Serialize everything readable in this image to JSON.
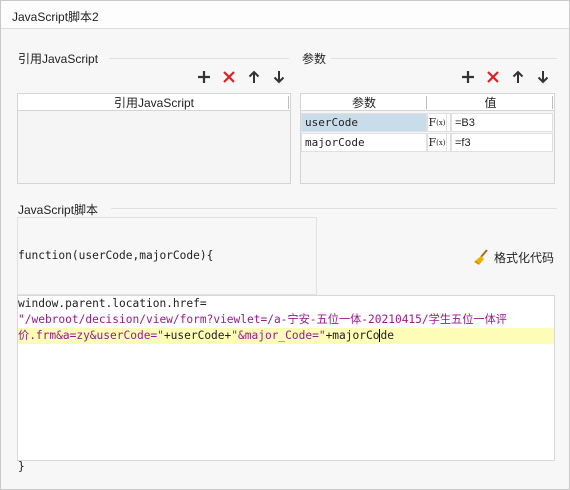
{
  "window": {
    "title": "JavaScript脚本2"
  },
  "ref_section": {
    "label": "引用JavaScript",
    "column_header": "引用JavaScript",
    "toolbar": [
      {
        "icon": "plus-icon",
        "color": "#333333"
      },
      {
        "icon": "close-icon",
        "color": "#e02020"
      },
      {
        "icon": "arrow-up-icon",
        "color": "#333333"
      },
      {
        "icon": "arrow-down-icon",
        "color": "#333333"
      }
    ]
  },
  "params_section": {
    "label": "参数",
    "headers": {
      "name": "参数",
      "value": "值"
    },
    "rows": [
      {
        "name": "userCode",
        "fx": "F",
        "fx_sub": "(x)",
        "value": "=B3",
        "selected": true
      },
      {
        "name": "majorCode",
        "fx": "F",
        "fx_sub": "(x)",
        "value": "=f3",
        "selected": false
      }
    ]
  },
  "script_section": {
    "label": "JavaScript脚本",
    "function_header": "function(userCode,majorCode){",
    "format_button": "格式化代码",
    "code": {
      "line1": "window.parent.location.href=",
      "line2": "\"/webroot/decision/view/form?viewlet=/a-宁安-五位一体-20210415/学生五位一体评",
      "line3_str1": "价.frm&a=zy&userCode=\"",
      "line3_mid1": "+userCode+",
      "line3_str2": "\"&major_Code=\"",
      "line3_mid2": "+majorCo",
      "line3_after_cursor": "de"
    },
    "closing": "}"
  },
  "colors": {
    "selected_row": "#c9dcea",
    "string": "#9a1a8e",
    "highlight_line": "#fdfdb8"
  }
}
